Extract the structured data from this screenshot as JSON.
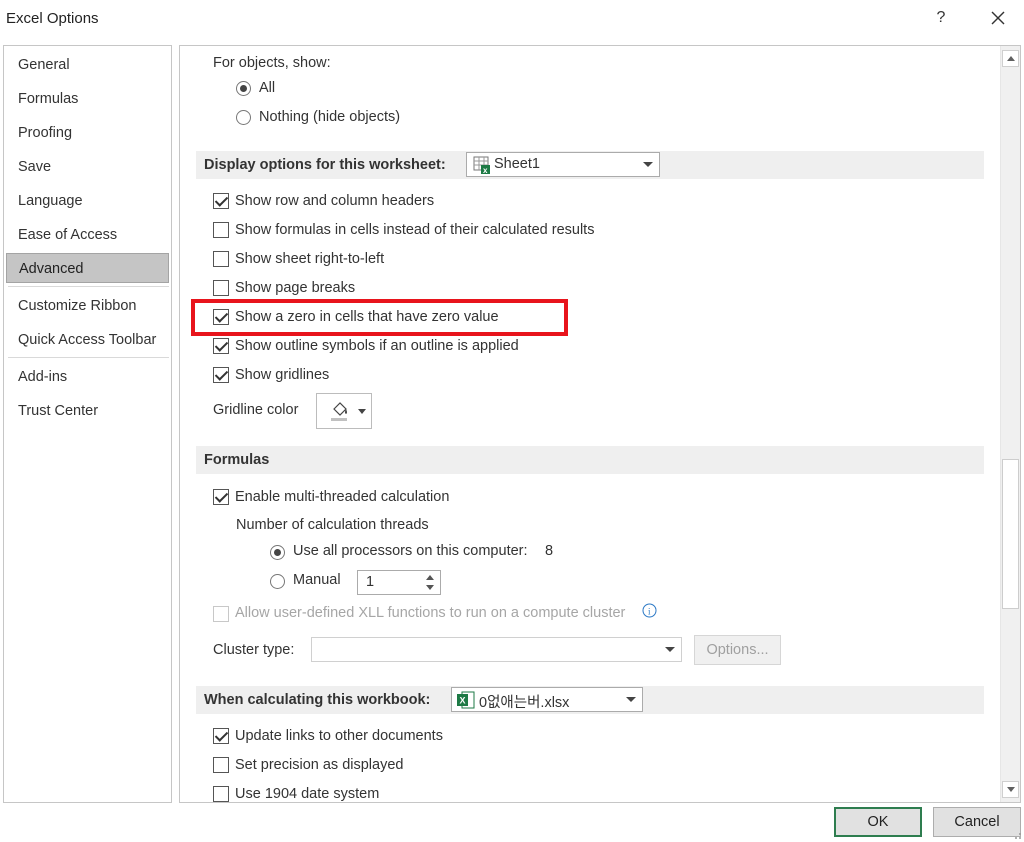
{
  "window": {
    "title": "Excel Options",
    "help": "?",
    "close": "×"
  },
  "nav": {
    "items": [
      "General",
      "Formulas",
      "Proofing",
      "Save",
      "Language",
      "Ease of Access",
      "Advanced",
      "Customize Ribbon",
      "Quick Access Toolbar",
      "Add-ins",
      "Trust Center"
    ],
    "selected": "Advanced"
  },
  "objects": {
    "label": "For objects, show:",
    "all": "All",
    "nothing": "Nothing (hide objects)"
  },
  "worksheet": {
    "header": "Display options for this worksheet:",
    "sheet": "Sheet1",
    "options": [
      {
        "label": "Show row and column headers",
        "checked": true
      },
      {
        "label": "Show formulas in cells instead of their calculated results",
        "checked": false
      },
      {
        "label": "Show sheet right-to-left",
        "checked": false
      },
      {
        "label": "Show page breaks",
        "checked": false
      },
      {
        "label": "Show a zero in cells that have zero value",
        "checked": true
      },
      {
        "label": "Show outline symbols if an outline is applied",
        "checked": true
      },
      {
        "label": "Show gridlines",
        "checked": true
      }
    ],
    "gridline_color_label": "Gridline color"
  },
  "formulas": {
    "header": "Formulas",
    "multithread": "Enable multi-threaded calculation",
    "threads_label": "Number of calculation threads",
    "all_processors": "Use all processors on this computer:",
    "processor_count": "8",
    "manual": "Manual",
    "manual_value": "1",
    "xll": "Allow user-defined XLL functions to run on a compute cluster",
    "cluster_type": "Cluster type:",
    "options_btn": "Options..."
  },
  "workbook": {
    "header": "When calculating this workbook:",
    "file": "0없애는버.xlsx",
    "options": [
      {
        "label": "Update links to other documents",
        "checked": true
      },
      {
        "label": "Set precision as displayed",
        "checked": false
      },
      {
        "label": "Use 1904 date system",
        "checked": false
      }
    ]
  },
  "footer": {
    "ok": "OK",
    "cancel": "Cancel"
  },
  "colors": {
    "highlight": "#e8141c",
    "ok_border": "#2e7d4f",
    "excel_green": "#1d7a45"
  }
}
